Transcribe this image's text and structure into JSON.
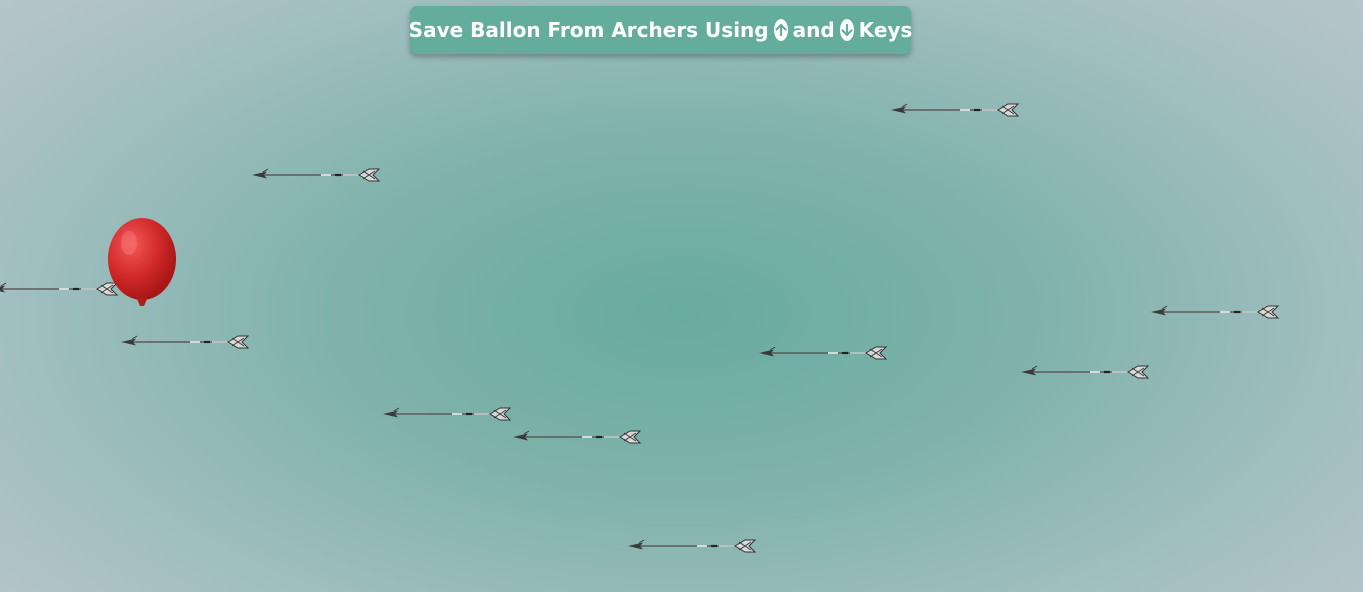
{
  "banner": {
    "text_before": "Save Ballon From Archers Using",
    "up_icon": "arrow-up-circle-icon",
    "text_middle": "and",
    "down_icon": "arrow-down-circle-icon",
    "text_after": "Keys"
  },
  "colors": {
    "banner_background": "#64ad9d",
    "banner_text": "#ffffff",
    "background_center": "#68aba0",
    "background_edge": "#bcc6cf",
    "balloon": "#d42a2a",
    "arrow": "#4a4a4a"
  },
  "game": {
    "player": "red-balloon",
    "obstacle": "arrow",
    "arrow_direction": "left"
  }
}
